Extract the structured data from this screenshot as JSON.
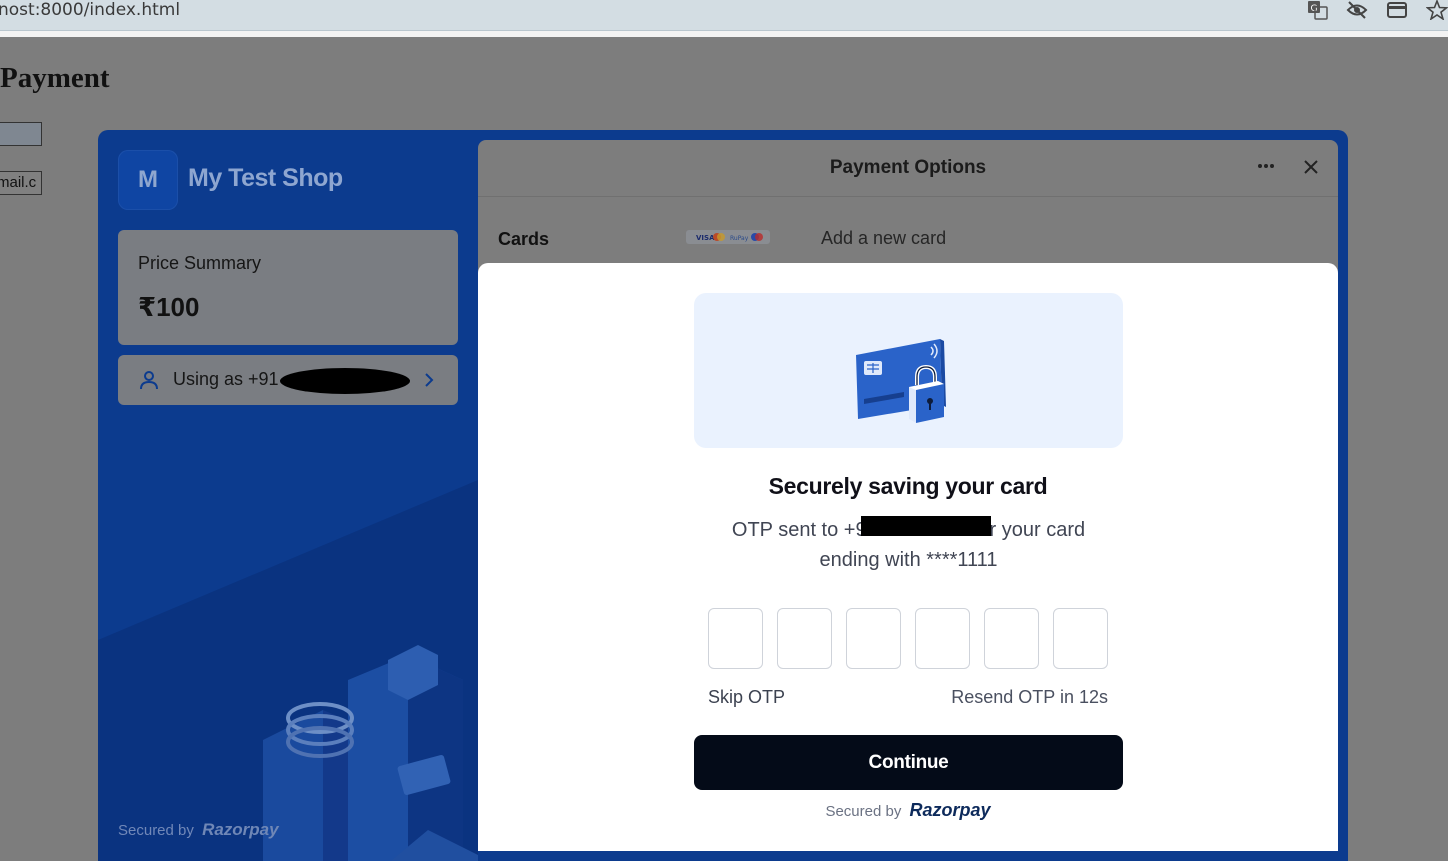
{
  "browser": {
    "url": "nost:8000/index.html"
  },
  "page": {
    "title": "Payment",
    "input1_value": "",
    "input2_value": "mail.c"
  },
  "checkout": {
    "merchant_initial": "M",
    "merchant_name": "My Test Shop",
    "price_summary_label": "Price Summary",
    "price_amount": "₹100",
    "user_label": "Using as +91",
    "footer_secured": "Secured by",
    "footer_brand": "Razorpay",
    "header_title": "Payment Options",
    "cards_label": "Cards",
    "add_card_label": "Add a new card",
    "accent_color": "#0c3b8e"
  },
  "modal": {
    "title": "Securely saving your card",
    "description_line1": "OTP sent to +919",
    "description_line1_end": "for your card",
    "description_line2": "ending with ****1111",
    "otp_digits": [
      "",
      "",
      "",
      "",
      "",
      ""
    ],
    "skip_label": "Skip OTP",
    "resend_label": "Resend OTP in 12s",
    "continue_label": "Continue",
    "footer_secured": "Secured by",
    "footer_brand": "Razorpay"
  }
}
